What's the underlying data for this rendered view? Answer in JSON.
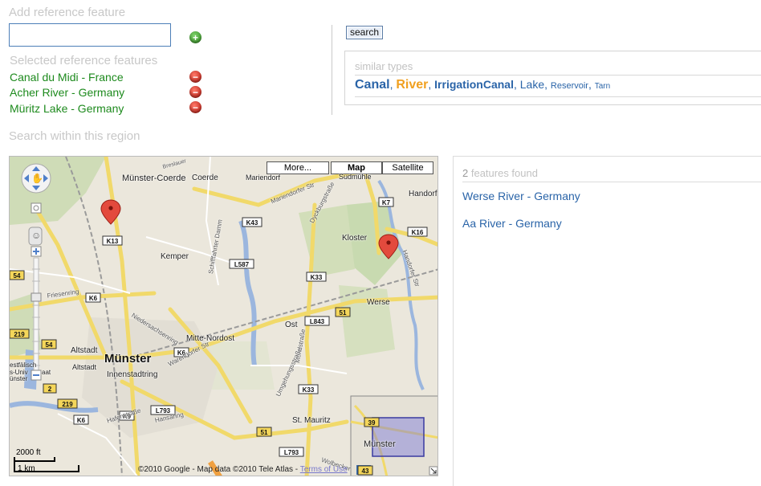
{
  "add_reference": {
    "title": "Add reference feature",
    "input_value": "",
    "add_icon": "plus-circle-icon"
  },
  "selected": {
    "title": "Selected reference features",
    "items": [
      {
        "label": "Canal du Midi - France",
        "remove_icon": "minus-circle-icon"
      },
      {
        "label": "Acher River - Germany",
        "remove_icon": "minus-circle-icon"
      },
      {
        "label": "Müritz Lake - Germany",
        "remove_icon": "minus-circle-icon"
      }
    ]
  },
  "search": {
    "button_label": "search"
  },
  "similar_types": {
    "title": "similar types",
    "types": [
      {
        "label": "Canal",
        "size": 16,
        "color": "#2a64a8",
        "bold": true
      },
      {
        "label": "River",
        "size": 16,
        "color": "#f0a020",
        "bold": true
      },
      {
        "label": "IrrigationCanal",
        "size": 14,
        "color": "#2a64a8",
        "bold": true
      },
      {
        "label": "Lake",
        "size": 14,
        "color": "#2a64a8",
        "bold": false
      },
      {
        "label": "Reservoir",
        "size": 11,
        "color": "#2a64a8",
        "bold": false
      },
      {
        "label": "Tarn",
        "size": 10,
        "color": "#2a64a8",
        "bold": false
      }
    ],
    "separator": ", "
  },
  "region": {
    "title": "Search within this region"
  },
  "map": {
    "type_buttons": [
      "More...",
      "Map",
      "Satellite"
    ],
    "selected_type": "Map",
    "labels": {
      "muenster_coerde": "Münster-Coerde",
      "coerde": "Coerde",
      "mariendorf": "Mariendorf",
      "sudmuehle": "Sudmühle",
      "handorf": "Handorf",
      "kloster": "Kloster",
      "kemper": "Kemper",
      "werse": "Werse",
      "ost": "Ost",
      "mitte_nordost": "Mitte-Nordost",
      "altstadt1": "Altstadt",
      "altstadt2": "Altstadt",
      "muenster": "Münster",
      "innenstadtring": "Innenstadtring",
      "st_mauritz": "St. Mauritz",
      "muenster_mini": "Münster",
      "friesenring": "Friesenring",
      "breslauer": "Breslauer",
      "marienodorfer": "Mariendorfer Str",
      "dyckburg": "Dyckburgstraße",
      "warendorfer": "Warendorfer Str",
      "niedersachsenring": "Niedersachsenring",
      "hafenstrasse": "Hafenstraße",
      "hansaring": "Hansaring",
      "mondstrasse": "Mondstraße",
      "umgehung": "Umgehungsstraße",
      "wolbecker": "Wolbecker",
      "handorfer": "Handorfer Str",
      "schifffahrter": "Schifffahrter Damm",
      "westfaelisch": "estfälisch",
      "univ": "s-Univ",
      "unster": "ünster",
      "aat": "aat"
    },
    "road_badges": [
      "K13",
      "K43",
      "K7",
      "K16",
      "L587",
      "K33",
      "K6",
      "L843",
      "51",
      "K6",
      "54",
      "219",
      "K33",
      "K6",
      "K9",
      "L793",
      "51",
      "L793",
      "54",
      "219",
      "2",
      "39",
      "43"
    ],
    "scale_top": "2000 ft",
    "scale_bottom": "1 km",
    "copyright": "©2010 Google - Map data ©2010 Tele Atlas -",
    "terms": "Terms of Use"
  },
  "results": {
    "count": "2",
    "head_text": " features found",
    "items": [
      "Werse River - Germany",
      "Aa River - Germany"
    ]
  }
}
